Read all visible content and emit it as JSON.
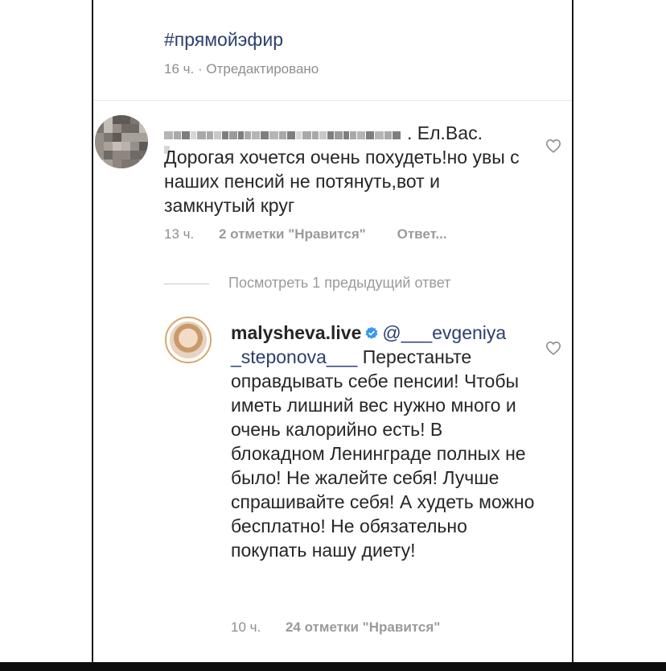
{
  "post": {
    "hashtag": "#прямойэфир",
    "meta_time": "16 ч.",
    "meta_separator": "·",
    "meta_edited": "Отредактировано"
  },
  "comment1": {
    "avatar_state": "pixelated",
    "username_state": "pixelated",
    "text_lead": ". Ел.Вас.",
    "text_body": "Дорогая хочется очень похудеть!но увы с наших пенсий не потянуть,вот и замкнутый круг",
    "time": "13 ч.",
    "likes": "2 отметки \"Нравится\"",
    "reply": "Ответ..."
  },
  "view_previous": {
    "label": "Посмотреть 1 предыдущий ответ"
  },
  "comment2": {
    "username": "malysheva.live",
    "mention": "@___evgeniya _steponova___",
    "text_body": "Перестаньте оправдывать себе пенсии! Чтобы иметь лишний вес нужно много и очень калорийно есть! В блокадном Ленинграде полных не было! Не жалейте себя! Лучше спрашивайте себя! А худеть можно бесплатно! Не обязательно покупать нашу диету!",
    "time": "10 ч.",
    "likes": "24 отметки \"Нравится\""
  },
  "colors": {
    "link": "#2b3f6e",
    "meta": "#8e8e8e",
    "verified": "#3897f0",
    "text": "#262626"
  },
  "icons": {
    "like": "heart-outline-icon",
    "verified": "verified-badge-icon"
  }
}
